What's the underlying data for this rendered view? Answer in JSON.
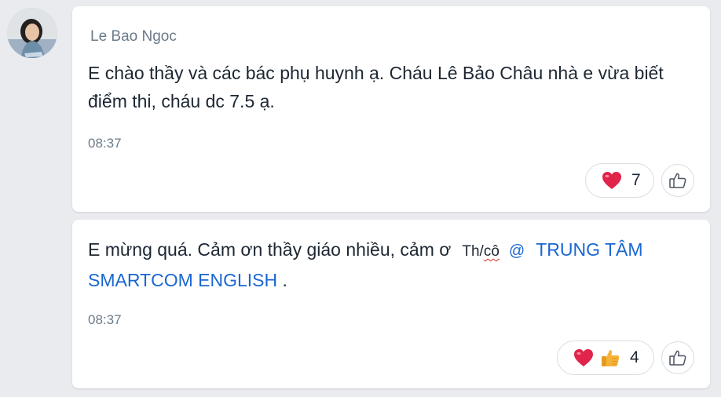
{
  "messages": [
    {
      "sender": "Le Bao Ngoc",
      "text": "E chào thầy và các bác phụ huynh ạ. Cháu Lê Bảo Châu nhà e vừa biết điểm thi, cháu dc 7.5 ạ.",
      "time": "08:37",
      "reactions": {
        "icons": [
          "heart-icon"
        ],
        "count": "7"
      }
    },
    {
      "text_before": "E mừng quá. Cảm ơn thầy giáo nhiều, cảm ơ",
      "mention_trigger_before": "Th/",
      "mention_trigger_typo": "cô",
      "mention_at": "@",
      "mention": "TRUNG TÂM SMARTCOM ENGLISH",
      "text_after": " .",
      "time": "08:37",
      "reactions": {
        "icons": [
          "heart-icon",
          "thumbs-up-icon"
        ],
        "count": "4"
      }
    }
  ],
  "colors": {
    "accent": "#1a66d2",
    "heart": "#e0244a",
    "thumb": "#f5b33a"
  }
}
